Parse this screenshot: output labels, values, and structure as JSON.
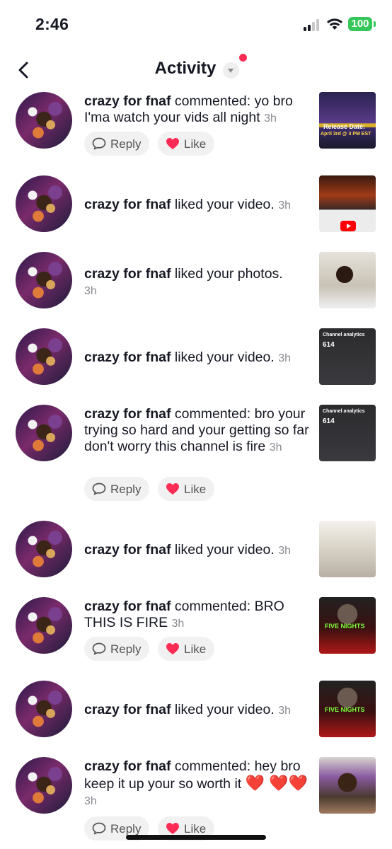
{
  "status_bar": {
    "time": "2:46",
    "battery": "100"
  },
  "nav": {
    "title": "Activity"
  },
  "labels": {
    "reply": "Reply",
    "like": "Like"
  },
  "items": [
    {
      "user": "crazy for fnaf",
      "message": " commented: yo bro I'ma watch your vids all night ",
      "time": "3h"
    },
    {
      "user": "crazy for fnaf",
      "message": " liked your video. ",
      "time": "3h"
    },
    {
      "user": "crazy for fnaf",
      "message": " liked your photos. ",
      "time": "3h"
    },
    {
      "user": "crazy for fnaf",
      "message": " liked your video. ",
      "time": "3h"
    },
    {
      "user": "crazy for fnaf",
      "message": " commented: bro your trying so hard and your getting so far don't worry this channel is fire ",
      "time": "3h"
    },
    {
      "user": "crazy for fnaf",
      "message": " liked your video. ",
      "time": "3h"
    },
    {
      "user": "crazy for fnaf",
      "message": " commented: BRO THIS IS FIRE ",
      "time": "3h"
    },
    {
      "user": "crazy for fnaf",
      "message": " liked your video. ",
      "time": "3h"
    },
    {
      "user": "crazy for fnaf",
      "message": " commented: hey bro keep it up your so worth it ",
      "emoji": "❤️ ❤️❤️",
      "time": "3h"
    }
  ],
  "thumbnails": {
    "release_date": "Release Date:",
    "release_time": "April 3rd @ 3 PM EST",
    "channel_analytics": "Channel analytics",
    "subscribers": "614",
    "fnaf_logo": "FIVE NIGHTS"
  },
  "colors": {
    "accent": "#fe2c55",
    "battery": "#35c759",
    "like": "#fe2c55",
    "muted": "#8a8b91"
  }
}
